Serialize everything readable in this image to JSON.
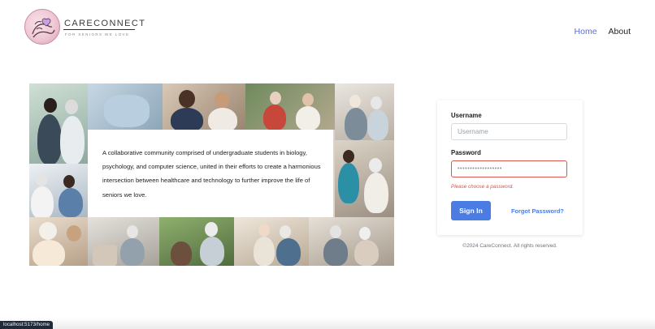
{
  "header": {
    "logo_text": "CARECONNECT",
    "logo_tagline": "FOR SENIORS WE LOVE",
    "nav": [
      {
        "label": "Home",
        "active": true
      },
      {
        "label": "About",
        "active": false
      }
    ]
  },
  "hero": {
    "intro": "A collaborative community comprised of undergraduate students in biology, psychology, and computer science, united in their efforts to create a harmonious intersection between healthcare and technology to further improve the life of seniors we love."
  },
  "login": {
    "username_label": "Username",
    "username_placeholder": "Username",
    "username_value": "",
    "password_label": "Password",
    "password_value": "••••••••••••••••••",
    "password_error": "Please choose a password.",
    "signin_label": "Sign In",
    "forgot_label": "Forgot Password?"
  },
  "footer": {
    "copyright": "©2024 CareConnect. All rights reserved."
  },
  "status_bar": {
    "url": "localhost:5173/home"
  },
  "colors": {
    "accent": "#4a7ce4",
    "nav_active": "#5b6ee1",
    "error": "#d9534f",
    "logo_pink": "#efc7d5"
  },
  "icons": [
    "careconnect-logo-icon"
  ]
}
